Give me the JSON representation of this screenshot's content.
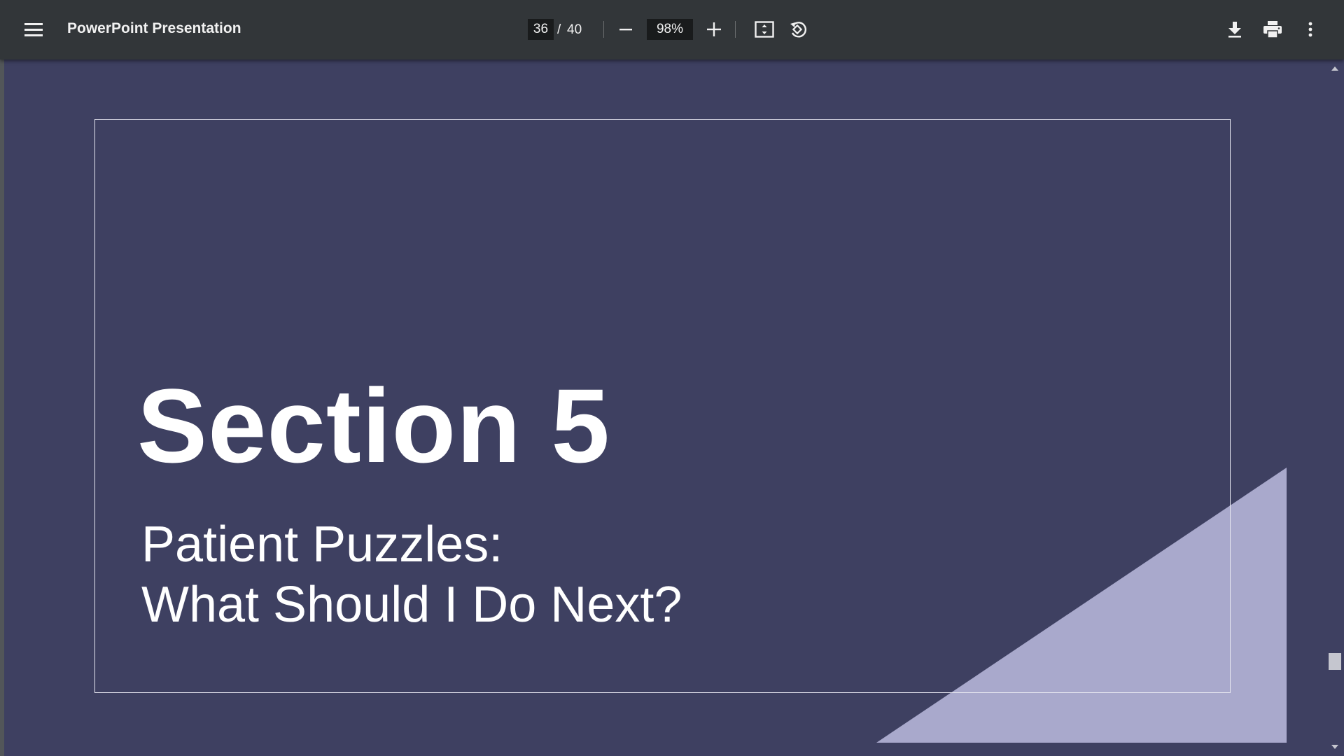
{
  "toolbar": {
    "title": "PowerPoint Presentation",
    "current_page": "36",
    "page_separator": "/",
    "total_pages": "40",
    "zoom": "98%",
    "icons": {
      "menu": "hamburger-menu-icon",
      "zoom_out": "minus-icon",
      "zoom_in": "plus-icon",
      "fit": "fit-to-page-icon",
      "rotate": "rotate-counterclockwise-icon",
      "download": "download-icon",
      "print": "print-icon",
      "more": "more-vertical-icon"
    }
  },
  "slide": {
    "title": "Section 5",
    "subtitle_line1": "Patient Puzzles:",
    "subtitle_line2": "What Should I Do Next?",
    "colors": {
      "background": "#3e4061",
      "triangle": "#a9a9cc",
      "frame": "#e6e6f0",
      "text": "#ffffff"
    }
  },
  "colors": {
    "toolbar_bg": "#323639",
    "input_bg": "#191b1c"
  }
}
